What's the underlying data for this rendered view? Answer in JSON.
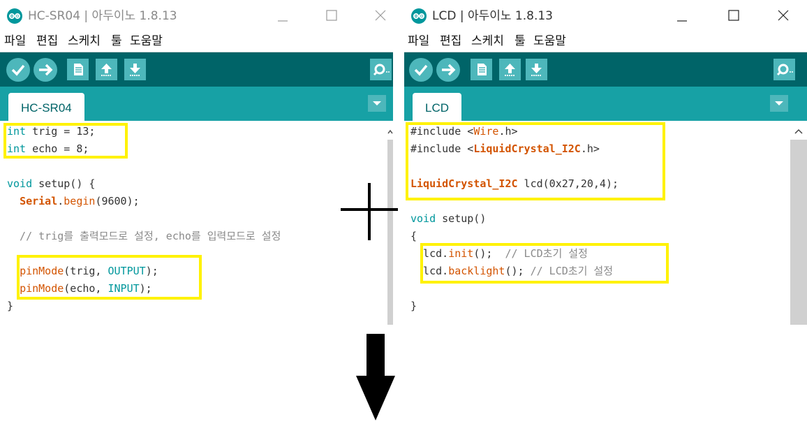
{
  "left_window": {
    "title": "HC-SR04 | 아두이노 1.8.13",
    "menu": [
      "파일",
      "편집",
      "스케치",
      "툴",
      "도움말"
    ],
    "tab_label": "HC-SR04",
    "code": [
      "int trig = 13;",
      "int echo = 8;",
      "",
      "void setup() {",
      "  Serial.begin(9600);",
      "",
      "  // trig를 출력모드로 설정, echo를 입력모드로 설정",
      "",
      "  pinMode(trig, OUTPUT);",
      "  pinMode(echo, INPUT);",
      "}"
    ]
  },
  "right_window": {
    "title": "LCD | 아두이노 1.8.13",
    "menu": [
      "파일",
      "편집",
      "스케치",
      "툴",
      "도움말"
    ],
    "tab_label": "LCD",
    "code": [
      "#include <Wire.h>",
      "#include <LiquidCrystal_I2C.h>",
      "",
      "LiquidCrystal_I2C lcd(0x27,20,4);",
      "",
      "void setup()",
      "{",
      "  lcd.init();  // LCD초기 설정",
      "  lcd.backlight(); // LCD초기 설정",
      "",
      "}"
    ]
  },
  "colors": {
    "toolbar": "#006468",
    "tabbar": "#17a1a5",
    "button": "#4db7bb",
    "keyword": "#00979c",
    "function": "#d35400",
    "comment": "#8a8a8a",
    "highlight": "#fff200"
  },
  "icons": [
    "arduino-logo-icon",
    "minimize-icon",
    "maximize-icon",
    "close-icon",
    "verify-icon",
    "upload-icon",
    "new-sketch-icon",
    "open-icon",
    "save-icon",
    "serial-monitor-icon",
    "tab-menu-icon",
    "scroll-up-icon",
    "plus-sign-icon",
    "arrow-down-icon"
  ]
}
